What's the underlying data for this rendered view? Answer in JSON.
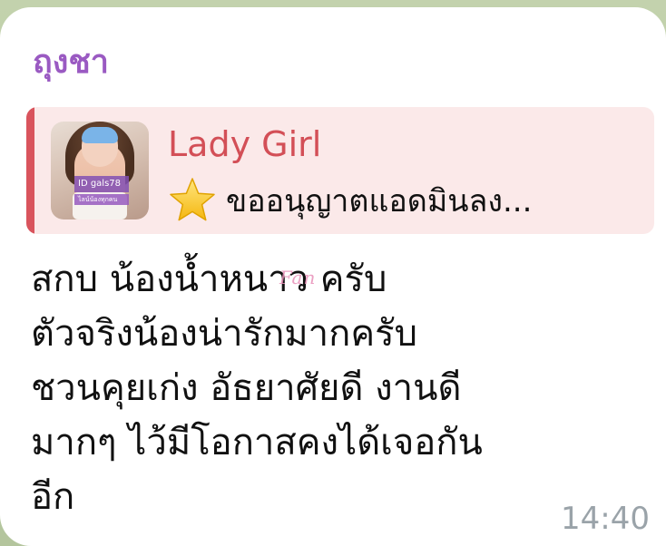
{
  "message": {
    "sender_name": "ถุงชา",
    "reply": {
      "name": "Lady Girl",
      "icon": "star-icon",
      "preview_text": "ขออนุญาตแอดมินลง...",
      "thumbnail": {
        "tag_line1": "ID  gals78",
        "tag_line2": "ไลน์น้องทุกคน"
      }
    },
    "lines": [
      "สกบ น้องน้ำหนาว ครับ",
      "ตัวจริงน้องน่ารักมากครับ",
      "ชวนคุยเก่ง อัธยาศัยดี งานดี",
      "มากๆ ไว้มีโอกาสคงได้เจอกัน",
      "อีก"
    ],
    "watermark": "Fan",
    "time": "14:40"
  },
  "colors": {
    "sender": "#9a5ac2",
    "reply_accent": "#d9545d",
    "reply_bg": "#fbe9e9",
    "time": "#9aa3a9"
  }
}
